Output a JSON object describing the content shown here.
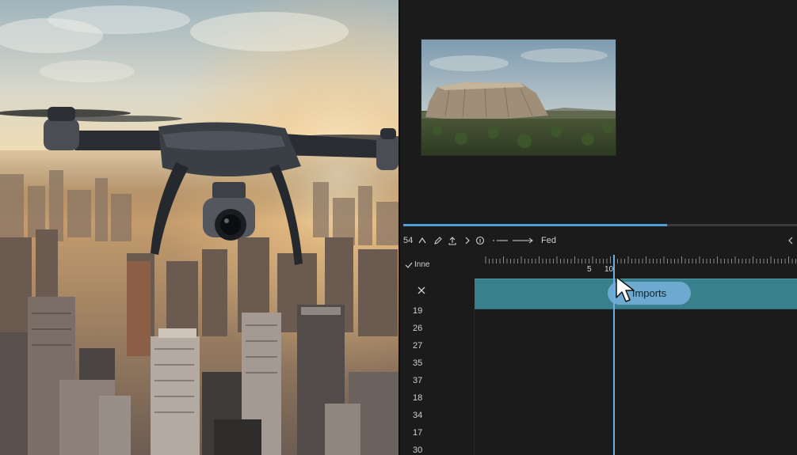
{
  "photo": {
    "subject": "drone-over-city"
  },
  "preview": {
    "subject": "landscape-thumbnail"
  },
  "playback": {
    "progress": 0.67
  },
  "toolbar": {
    "timecode": "54",
    "fed_label": "Fed"
  },
  "track_header": {
    "label": "Inne"
  },
  "ruler": {
    "label_a": "5",
    "label_b": "10"
  },
  "clip": {
    "label": "Imports"
  },
  "track_numbers": [
    "19",
    "26",
    "27",
    "35",
    "37",
    "18",
    "34",
    "17",
    "30"
  ],
  "colors": {
    "accent": "#4f9fd8",
    "clip_bg": "#3a7f8c",
    "clip_pill": "#6ea9cf",
    "panel_bg": "#1b1b1c"
  }
}
